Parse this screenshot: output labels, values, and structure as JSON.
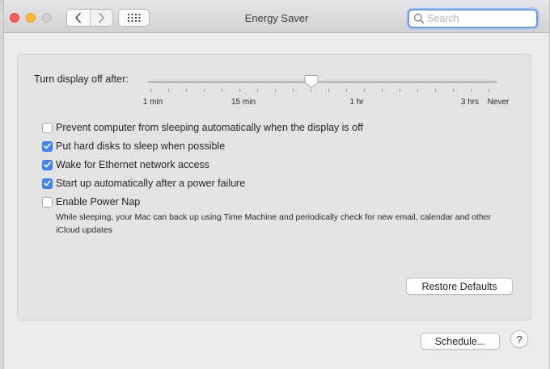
{
  "window": {
    "title": "Energy Saver"
  },
  "toolbar": {
    "search_placeholder": "Search"
  },
  "slider": {
    "label": "Turn display off after:",
    "ticks": [
      "1 min",
      "15 min",
      "1 hr",
      "3 hrs",
      "Never"
    ]
  },
  "options": [
    {
      "label": "Prevent computer from sleeping automatically when the display is off",
      "checked": false
    },
    {
      "label": "Put hard disks to sleep when possible",
      "checked": true
    },
    {
      "label": "Wake for Ethernet network access",
      "checked": true
    },
    {
      "label": "Start up automatically after a power failure",
      "checked": true
    },
    {
      "label": "Enable Power Nap",
      "checked": false
    }
  ],
  "power_nap_description": "While sleeping, your Mac can back up using Time Machine and periodically check for new email, calendar and other iCloud updates",
  "buttons": {
    "restore_defaults": "Restore Defaults",
    "schedule": "Schedule...",
    "help": "?"
  },
  "colors": {
    "accent": "#3d85f5",
    "close": "#fd5f57",
    "minimize": "#febb2e"
  }
}
